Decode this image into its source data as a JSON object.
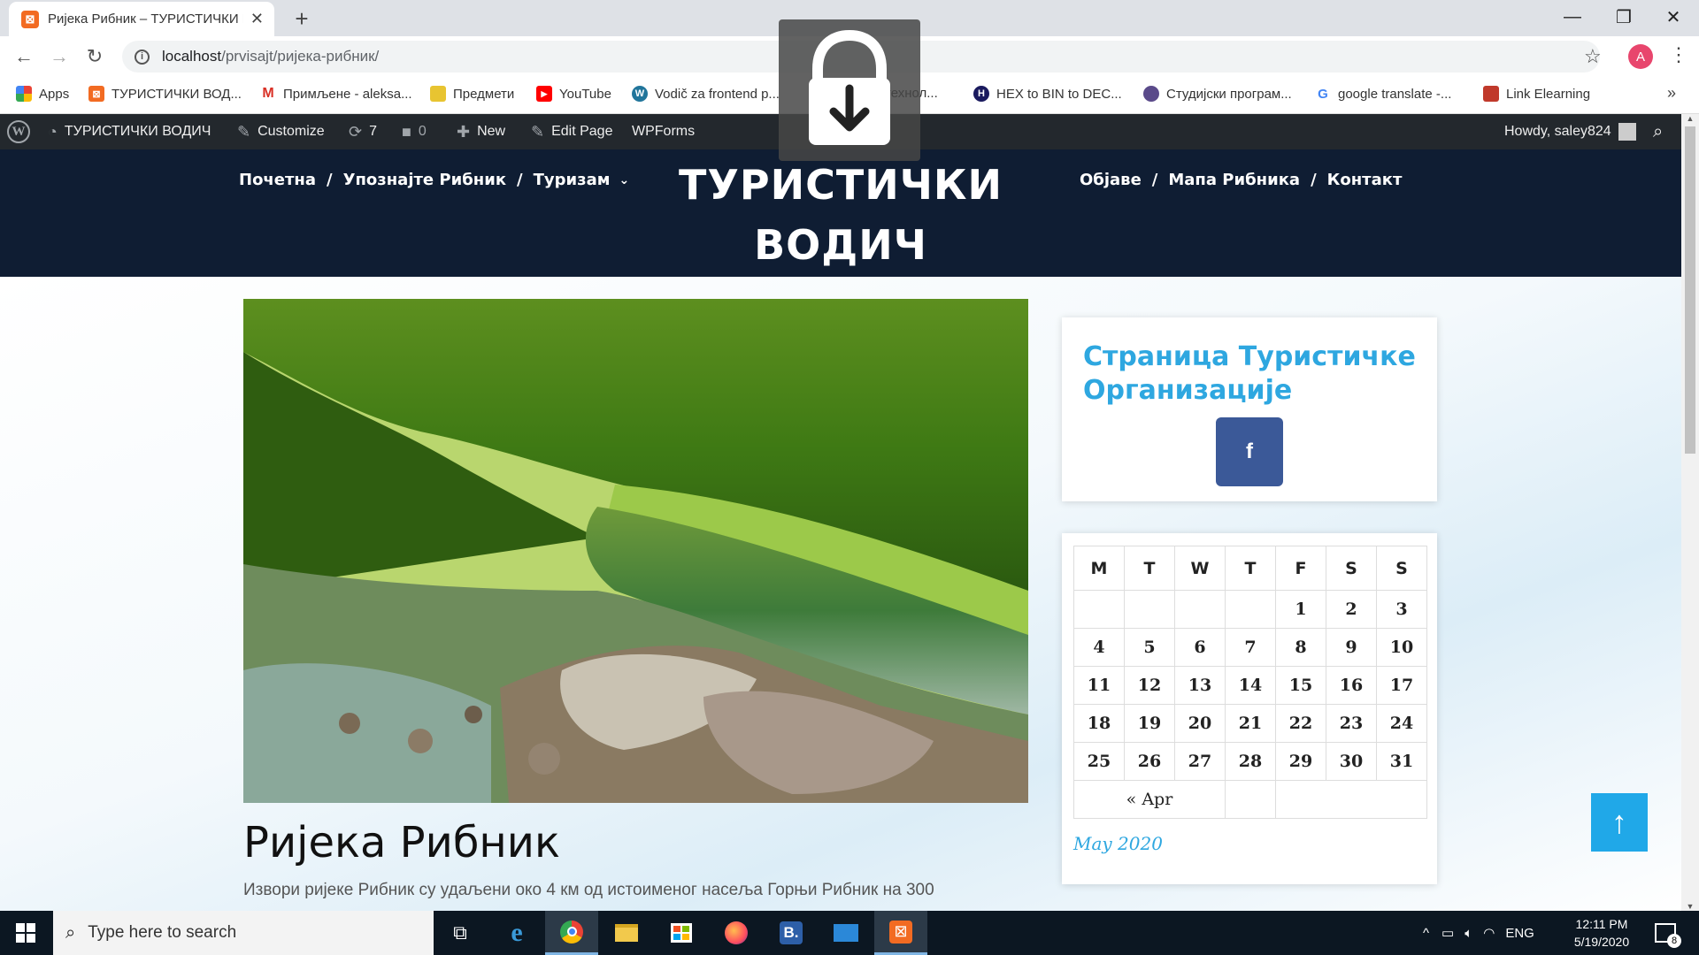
{
  "browser": {
    "tab_title": "Ријека Рибник – ТУРИСТИЧКИ ВОДИЧ",
    "tab_favicon": "xampp-icon",
    "url_host": "localhost",
    "url_path": "/prvisajt/ријека-рибник/",
    "profile_initial": "A",
    "bookmarks": [
      {
        "label": "Apps",
        "icon": "apps-grid-icon"
      },
      {
        "label": "ТУРИСТИЧКИ ВОД...",
        "icon": "xampp-icon"
      },
      {
        "label": "Примљене - aleksa...",
        "icon": "gmail-icon"
      },
      {
        "label": "Предмети",
        "icon": "folder-icon"
      },
      {
        "label": "YouTube",
        "icon": "youtube-icon"
      },
      {
        "label": "Vodič za frontend p...",
        "icon": "wordpress-icon"
      },
      {
        "label": "технол...",
        "icon": "globe-icon"
      },
      {
        "label": "HEX to BIN to DEC...",
        "icon": "hex-icon"
      },
      {
        "label": "Студијски програм...",
        "icon": "university-icon"
      },
      {
        "label": "google translate -...",
        "icon": "google-icon"
      },
      {
        "label": "Link Elearning",
        "icon": "elearning-icon"
      }
    ]
  },
  "adminbar": {
    "site_name": "ТУРИСТИЧКИ ВОДИЧ",
    "customize": "Customize",
    "updates_count": "7",
    "comments_count": "0",
    "new_label": "New",
    "edit_page": "Edit Page",
    "wpforms": "WPForms",
    "howdy": "Howdy, saley824"
  },
  "header": {
    "site_title": "ТУРИСТИЧКИ ВОДИЧ",
    "menu_left": [
      "Почетна",
      "Упознајте Рибник",
      "Туризам"
    ],
    "menu_right": [
      "Објаве",
      "Мапа Рибника",
      "Контакт"
    ]
  },
  "post": {
    "title": "Ријека Рибник",
    "excerpt": "Извори ријеке Рибник су удаљени око 4 км од истоименог насеља Горњи Рибник на 300"
  },
  "sidebar": {
    "fb_widget_title": "Страница Туристичке Организације",
    "fb_icon": "facebook-icon",
    "calendar": {
      "days": [
        "M",
        "T",
        "W",
        "T",
        "F",
        "S",
        "S"
      ],
      "weeks": [
        [
          "",
          "",
          "",
          "",
          "1",
          "2",
          "3"
        ],
        [
          "4",
          "5",
          "6",
          "7",
          "8",
          "9",
          "10"
        ],
        [
          "11",
          "12",
          "13",
          "14",
          "15",
          "16",
          "17"
        ],
        [
          "18",
          "19",
          "20",
          "21",
          "22",
          "23",
          "24"
        ],
        [
          "25",
          "26",
          "27",
          "28",
          "29",
          "30",
          "31"
        ]
      ],
      "prev_link": "« Apr",
      "caption": "May 2020"
    }
  },
  "taskbar": {
    "search_placeholder": "Type here to search",
    "language": "ENG",
    "time": "12:11 PM",
    "date": "5/19/2020",
    "notifications": "8"
  },
  "colors": {
    "header_bg": "#0f1d33",
    "accent": "#2ea7e0",
    "facebook": "#3b5998",
    "adminbar_bg": "#23282d"
  }
}
